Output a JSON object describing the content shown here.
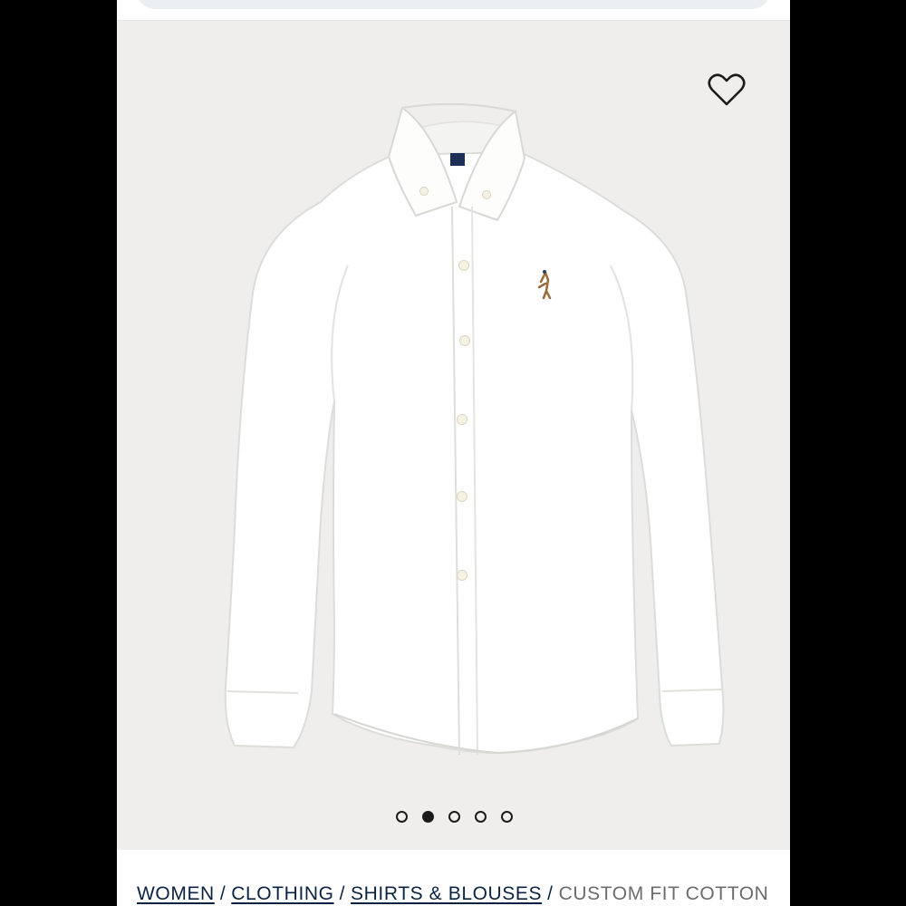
{
  "product": {
    "image_alt": "White Oxford shirt with button-down collar and embroidered pony logo",
    "logo_color": "#9b6a3a",
    "hero_background": "#efeeec"
  },
  "wishlist": {
    "icon": "heart-outline-icon"
  },
  "carousel": {
    "dot_count": 5,
    "active_index": 1
  },
  "breadcrumb": {
    "items": [
      "WOMEN",
      "CLOTHING",
      "SHIRTS & BLOUSES"
    ],
    "separator": "/",
    "current": "CUSTOM FIT COTTON"
  },
  "colors": {
    "navy": "#0b2343",
    "grey_text": "#6c6c6c",
    "frame": "#000000"
  }
}
